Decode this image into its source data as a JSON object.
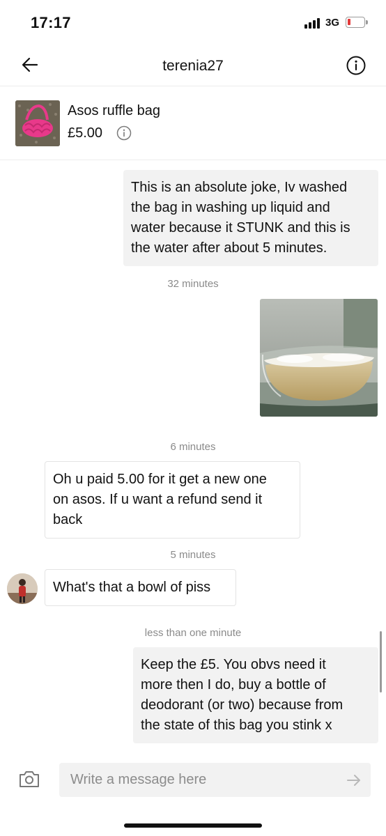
{
  "status_bar": {
    "time": "17:17",
    "network": "3G"
  },
  "header": {
    "title": "terenia27"
  },
  "item": {
    "name": "Asos ruffle bag",
    "price": "£5.00"
  },
  "messages": [
    {
      "direction": "out",
      "type": "text",
      "lines": [
        "This is an absolute joke, Iv washed",
        "the bag in washing up liquid and",
        "water because it STUNK and this is",
        "the water after about 5 minutes."
      ]
    },
    {
      "type": "timestamp",
      "text": "32 minutes"
    },
    {
      "direction": "out",
      "type": "photo",
      "description_icon": "photo-of-bowl-of-murky-water"
    },
    {
      "type": "timestamp",
      "text": "6 minutes"
    },
    {
      "direction": "in",
      "type": "text",
      "lines": [
        "Oh u paid 5.00 for it get a new one",
        "on asos. If u want a refund send it",
        "back"
      ]
    },
    {
      "type": "timestamp",
      "text": "5 minutes"
    },
    {
      "direction": "in",
      "type": "text",
      "lines": [
        "What's that a bowl of piss"
      ]
    },
    {
      "type": "timestamp",
      "text": "less than one minute"
    },
    {
      "direction": "out",
      "type": "text",
      "lines": [
        "Keep the £5. You obvs need it",
        "more then I do, buy a bottle of",
        "deodorant (or two) because from",
        "the state of this bag you stink x"
      ]
    }
  ],
  "composer": {
    "placeholder": "Write a message here"
  },
  "colors": {
    "accent_pink": "#e8398a",
    "bubble_out": "#f2f2f2",
    "timestamp": "#8a8a8a"
  }
}
